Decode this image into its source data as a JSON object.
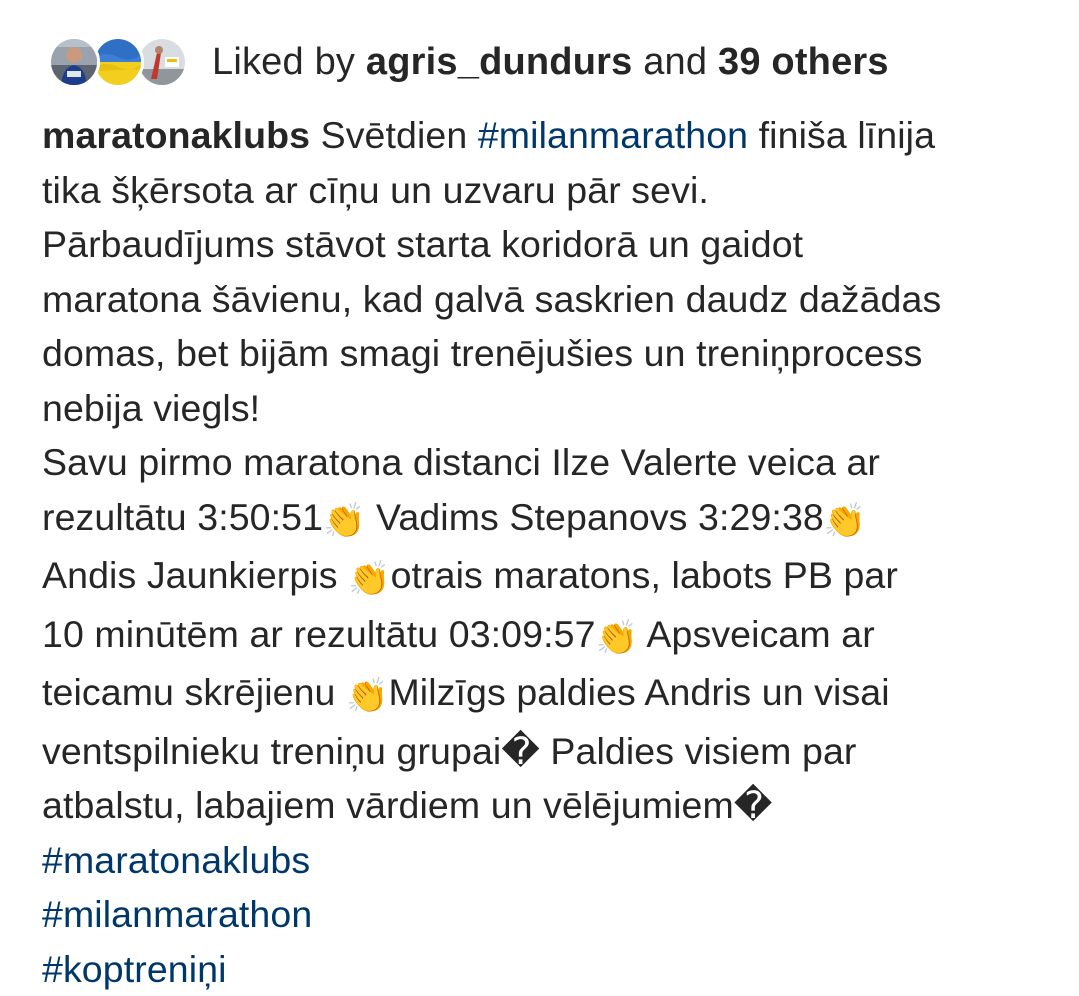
{
  "likes": {
    "prefix": "Liked by ",
    "user": "agris_dundurs",
    "middle": " and ",
    "others": "39 others",
    "avatars": [
      {
        "icon": "runner-photo-avatar"
      },
      {
        "icon": "ukraine-flag-avatar"
      },
      {
        "icon": "marathon-photo-avatar"
      }
    ]
  },
  "post": {
    "username": "maratonaklubs",
    "clap_emoji": "👏",
    "unsupported_char": "�",
    "lines": {
      "l1a": " Svētdien ",
      "l1tag": "#milanmarathon",
      "l1b": " finiša līnija",
      "l2": "tika šķērsota ar cīņu un uzvaru pār sevi.",
      "l3": "Pārbaudījums stāvot starta koridorā un gaidot",
      "l4": "maratona šāvienu, kad galvā saskrien daudz dažādas",
      "l5": "domas, bet bijām smagi trenējušies un treniņprocess",
      "l6": "nebija viegls!",
      "l7": "Savu pirmo maratona distanci Ilze Valerte veica ar",
      "l8a": "rezultātu 3:50:51",
      "l8b": " Vadims Stepanovs 3:29:38",
      "l9a": "Andis Jaunkierpis ",
      "l9b": "otrais maratons, labots PB par",
      "l10a": "10 minūtēm ar rezultātu 03:09:57",
      "l10b": " Apsveicam ar",
      "l11a": "teicamu skrējienu ",
      "l11b": "Milzīgs paldies Andris un visai",
      "l12a": "ventspilnieku treniņu grupai",
      "l12b": " Paldies visiem par",
      "l13a": "atbalstu, labajiem vārdiem un vēlējumiem"
    },
    "hashtags": [
      "#maratonaklubs",
      "#milanmarathon",
      "#koptreniņi"
    ]
  },
  "colors": {
    "text": "#262626",
    "hashtag": "#00376b",
    "background": "#ffffff"
  }
}
